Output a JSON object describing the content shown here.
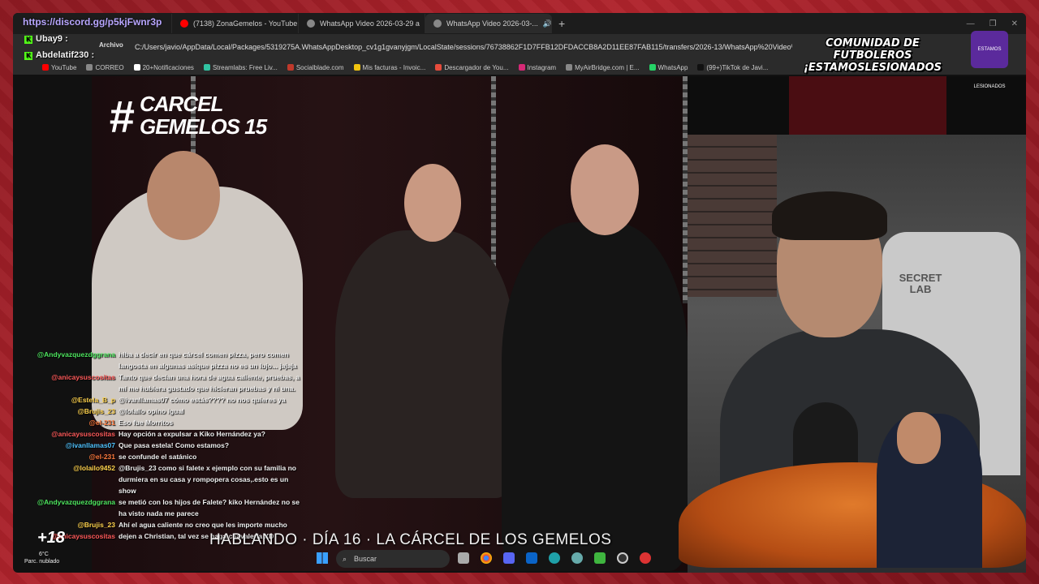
{
  "overlay": {
    "link": "https://discord.gg/p5kjFwnr3p",
    "viewer1": "Ubay9 :",
    "viewer2": "Abdelatif230 :",
    "banner_line1": "COMUNIDAD DE FUTBOLEROS",
    "banner_line2": "¡ESTAMOSLESIONADOS",
    "logo_text": "ESTAMOS LESIONADOS",
    "plus18": "+18"
  },
  "tabs": [
    {
      "label": "(7138) ZonaGemelos - YouTube",
      "color": "#ff0000"
    },
    {
      "label": "WhatsApp Video 2026-03-29 a",
      "color": "#888888"
    },
    {
      "label": "WhatsApp Video 2026-03-...",
      "color": "#888888"
    }
  ],
  "address": {
    "archivo": "Archivo",
    "url": "C:/Users/javio/AppData/Local/Packages/5319275A.WhatsAppDesktop_cv1g1gvanyjgm/LocalState/sessions/76738862F1D7FFB12DFDACCB8A2D11EE87FAB115/transfers/2026-13/WhatsApp%20Video%"
  },
  "bookmarks": [
    {
      "label": "YouTube",
      "color": "#ff0000"
    },
    {
      "label": "CORREO",
      "color": "#888888"
    },
    {
      "label": "20+Notificaciones",
      "color": "#ffffff"
    },
    {
      "label": "Streamlabs: Free Liv...",
      "color": "#31c3a2"
    },
    {
      "label": "Socialblade.com",
      "color": "#c0392b"
    },
    {
      "label": "Mis facturas - Invoic...",
      "color": "#f1c40f"
    },
    {
      "label": "Descargador de You...",
      "color": "#e74c3c"
    },
    {
      "label": "Instagram",
      "color": "#d62976"
    },
    {
      "label": "MyAirBridge.com | E...",
      "color": "#888888"
    },
    {
      "label": "WhatsApp",
      "color": "#25d366"
    },
    {
      "label": "(99+)TikTok de Javi...",
      "color": "#111111"
    }
  ],
  "video": {
    "title_hash": "#",
    "title_line1": "CARCEL",
    "title_line2": "GEMELOS 15"
  },
  "webcam": {
    "chair_brand": "SECRET LAB"
  },
  "chat": [
    {
      "user": "@Andyvazquezdggrana",
      "color": "#4ee65f",
      "text": "hiba a decir en que cárcel comen pizza, pero comen langosta en algunas asique pizza no es un lujo... jajaja"
    },
    {
      "user": "@anicaysuscositas",
      "color": "#ff5a5a",
      "text": "Tanto que decían una hora de agua caliente, pruebas, a mí me hubiera gustado que hicieran pruebas y ni una."
    },
    {
      "user": "@Estela_B_p",
      "color": "#ffd34d",
      "text": "@ivanllamas07 cómo estás???? no nos quieres ya"
    },
    {
      "user": "@Brujis_23",
      "color": "#ffd34d",
      "text": "@lolallo opino igual"
    },
    {
      "user": "@el-231",
      "color": "#ff7a3d",
      "text": "Eso fue Morritos"
    },
    {
      "user": "@anicaysuscositas",
      "color": "#ff5a5a",
      "text": "Hay opción a expulsar a Kiko Hernández ya?"
    },
    {
      "user": "@ivanllamas07",
      "color": "#4fc3ff",
      "text": "Que pasa estela! Como estamos?"
    },
    {
      "user": "@el-231",
      "color": "#ff7a3d",
      "text": "se confunde el satánico"
    },
    {
      "user": "@lolailo9452",
      "color": "#ffd34d",
      "text": "@Brujis_23 como si falete x ejemplo con su familia no durmiera en su casa y rompopera cosas,.esto es un show"
    },
    {
      "user": "@Andyvazquezdggrana",
      "color": "#4ee65f",
      "text": "se metió con los hijos de Falete? kiko Hernández no se ha visto nada me parece"
    },
    {
      "user": "@Brujis_23",
      "color": "#ffd34d",
      "text": "Ahí el agua caliente no creo que les importe mucho"
    },
    {
      "user": "@anicaysuscositas",
      "color": "#ff5a5a",
      "text": "dejen a Christian, tal vez se haga chavalería XD"
    }
  ],
  "caption": "HABLANDO  ·  DÍA 16  ·  LA CÁRCEL DE LOS GEMELOS",
  "taskbar": {
    "temp": "6°C",
    "weather": "Parc. nublado",
    "search_placeholder": "Buscar"
  }
}
